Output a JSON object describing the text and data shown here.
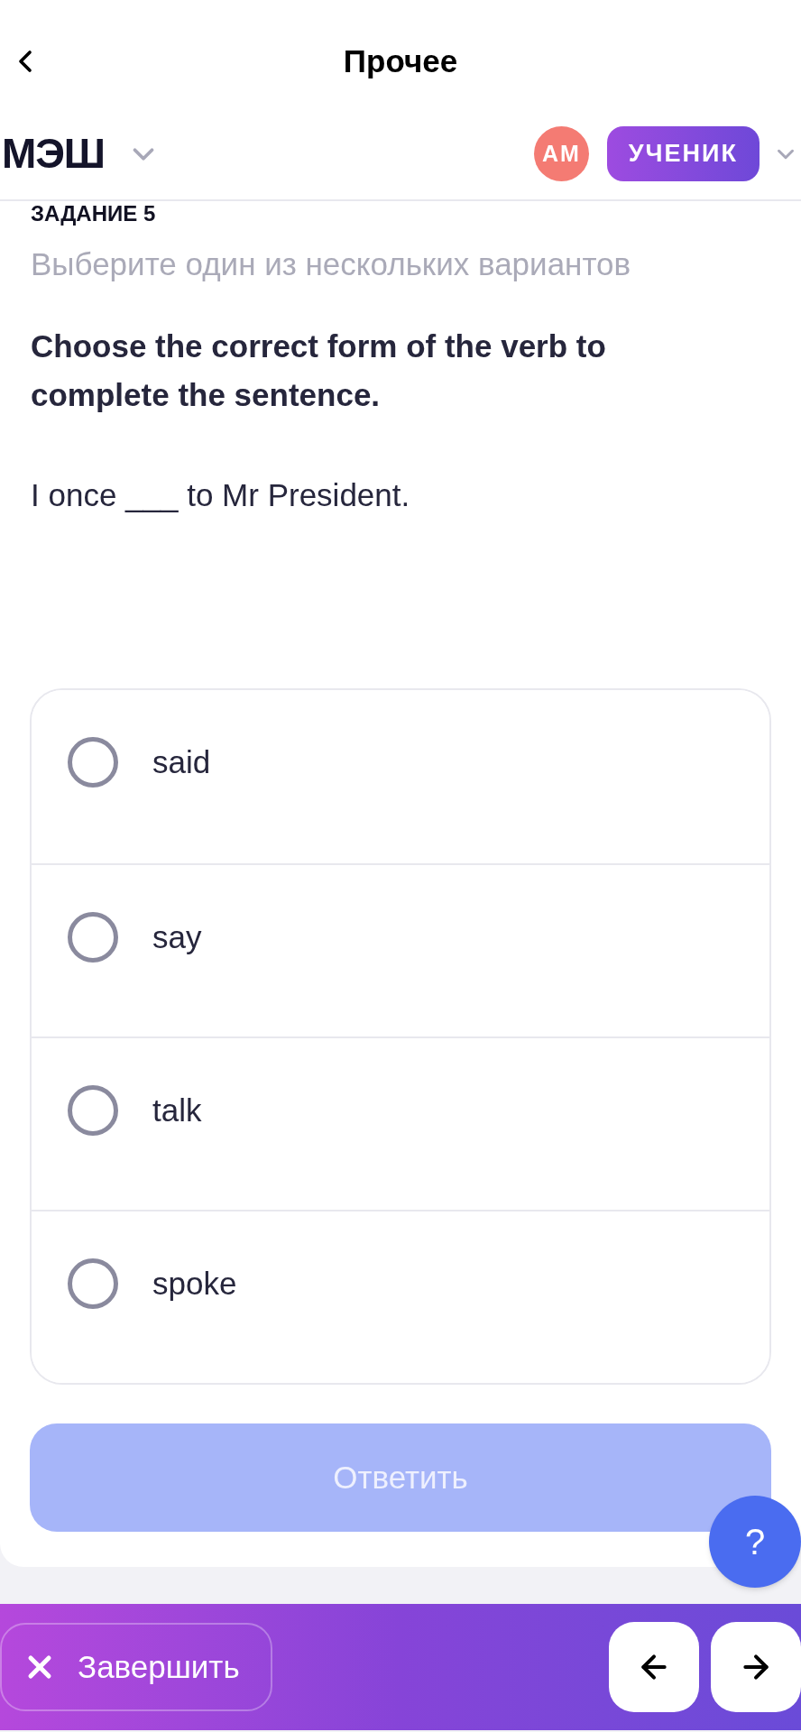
{
  "nav": {
    "title": "Прочее"
  },
  "header": {
    "logo": "МЭШ",
    "avatar_initials": "АМ",
    "role": "УЧЕНИК"
  },
  "task": {
    "label": "ЗАДАНИЕ 5",
    "instruction": "Выберите один из нескольких вариантов",
    "question": "Choose the correct form of the verb to complete the sentence.",
    "sentence": "I once ___ to Mr President."
  },
  "options": [
    {
      "label": "said",
      "selected": false
    },
    {
      "label": "say",
      "selected": false
    },
    {
      "label": "talk",
      "selected": false
    },
    {
      "label": "spoke",
      "selected": false
    }
  ],
  "answer_button": {
    "label": "Ответить",
    "disabled": true
  },
  "help_button": {
    "label": "?"
  },
  "bottom_bar": {
    "finish_button": {
      "label": "Завершить"
    }
  }
}
